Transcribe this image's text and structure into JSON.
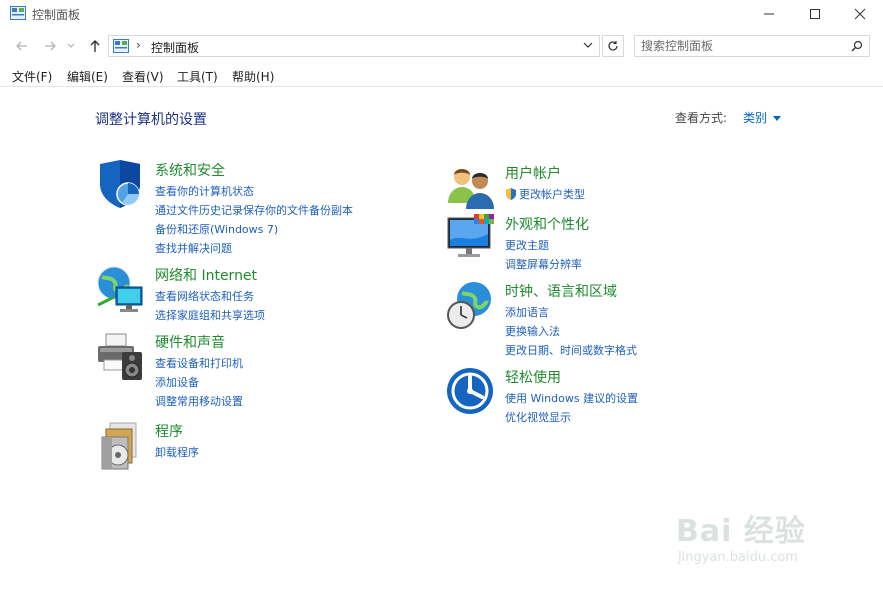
{
  "window": {
    "title": "控制面板"
  },
  "address": {
    "separator": "›",
    "crumb": "控制面板"
  },
  "search": {
    "placeholder": "搜索控制面板"
  },
  "menu": [
    {
      "label": "文件(F)"
    },
    {
      "label": "编辑(E)"
    },
    {
      "label": "查看(V)"
    },
    {
      "label": "工具(T)"
    },
    {
      "label": "帮助(H)"
    }
  ],
  "main": {
    "heading": "调整计算机的设置",
    "view_by_label": "查看方式:",
    "view_by_value": "类别"
  },
  "categories": {
    "system_security": {
      "title": "系统和安全",
      "links": [
        "查看你的计算机状态",
        "通过文件历史记录保存你的文件备份副本",
        "备份和还原(Windows 7)",
        "查找并解决问题"
      ]
    },
    "network": {
      "title": "网络和 Internet",
      "links": [
        "查看网络状态和任务",
        "选择家庭组和共享选项"
      ]
    },
    "hardware": {
      "title": "硬件和声音",
      "links": [
        "查看设备和打印机",
        "添加设备",
        "调整常用移动设置"
      ]
    },
    "programs": {
      "title": "程序",
      "links": [
        "卸载程序"
      ]
    },
    "user_accounts": {
      "title": "用户帐户",
      "links": [
        "更改帐户类型"
      ]
    },
    "appearance": {
      "title": "外观和个性化",
      "links": [
        "更改主题",
        "调整屏幕分辨率"
      ]
    },
    "clock": {
      "title": "时钟、语言和区域",
      "links": [
        "添加语言",
        "更换输入法",
        "更改日期、时间或数字格式"
      ]
    },
    "ease": {
      "title": "轻松使用",
      "links": [
        "使用 Windows 建议的设置",
        "优化视觉显示"
      ]
    }
  },
  "watermark": {
    "brand": "Bai 经验",
    "url": "jingyan.baidu.com"
  }
}
